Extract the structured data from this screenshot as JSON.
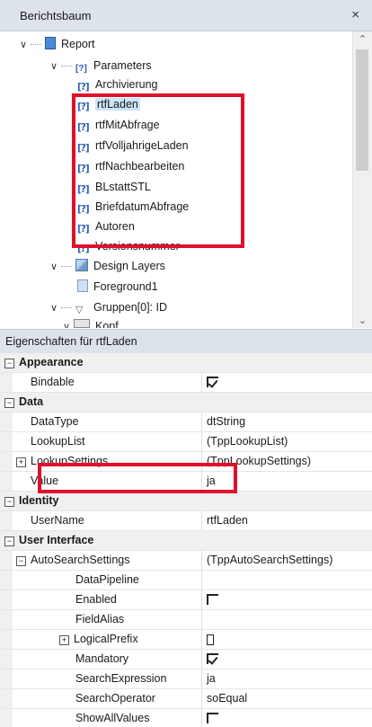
{
  "panel": {
    "title": "Berichtsbaum",
    "close_glyph": "×"
  },
  "tree": [
    {
      "label": "Report",
      "icon": "report-icon"
    },
    {
      "label": "Parameters",
      "icon": "parameters-icon"
    },
    {
      "label": "Archivierung",
      "icon": "parameter-icon"
    },
    {
      "label": "rtfLaden",
      "icon": "parameter-icon",
      "selected": true
    },
    {
      "label": "rtfMitAbfrage",
      "icon": "parameter-icon"
    },
    {
      "label": "rtfVolljahrigeLaden",
      "icon": "parameter-icon"
    },
    {
      "label": "rtfNachbearbeiten",
      "icon": "parameter-icon"
    },
    {
      "label": "BLstattSTL",
      "icon": "parameter-icon"
    },
    {
      "label": "BriefdatumAbfrage",
      "icon": "parameter-icon"
    },
    {
      "label": "Autoren",
      "icon": "parameter-icon"
    },
    {
      "label": "Versionsnummer",
      "icon": "parameter-icon"
    },
    {
      "label": "Design Layers",
      "icon": "layers-icon"
    },
    {
      "label": "Foreground1",
      "icon": "page-icon"
    },
    {
      "label": "Gruppen[0]: ID",
      "icon": "filter-icon"
    },
    {
      "label": "Kopf",
      "icon": "band-icon"
    }
  ],
  "param_glyph": "[?]",
  "props": {
    "header": "Eigenschaften für rtfLaden",
    "categories": {
      "appearance": "Appearance",
      "data": "Data",
      "identity": "Identity",
      "user_interface": "User Interface"
    },
    "rows": {
      "bindable": {
        "name": "Bindable",
        "value": true
      },
      "datatype": {
        "name": "DataType",
        "value": "dtString"
      },
      "lookuplist": {
        "name": "LookupList",
        "value": "(TppLookupList)"
      },
      "lookupsettings": {
        "name": "LookupSettings",
        "value": "(TppLookupSettings)"
      },
      "value": {
        "name": "Value",
        "value": "ja"
      },
      "username": {
        "name": "UserName",
        "value": "rtfLaden"
      },
      "autosearch": {
        "name": "AutoSearchSettings",
        "value": "(TppAutoSearchSettings)"
      },
      "datapipeline": {
        "name": "DataPipeline",
        "value": ""
      },
      "enabled": {
        "name": "Enabled",
        "value": false
      },
      "fieldalias": {
        "name": "FieldAlias",
        "value": ""
      },
      "logicalprefix": {
        "name": "LogicalPrefix",
        "value": ""
      },
      "mandatory": {
        "name": "Mandatory",
        "value": true
      },
      "searchexpression": {
        "name": "SearchExpression",
        "value": "ja"
      },
      "searchoperator": {
        "name": "SearchOperator",
        "value": "soEqual"
      },
      "showallvalues": {
        "name": "ShowAllValues",
        "value": false
      }
    },
    "collapse_glyph": "−",
    "expand_glyph": "+"
  },
  "colors": {
    "highlight_box": "#e0102a",
    "selection": "#cce4f7",
    "header_bg": "#dde3eb"
  }
}
